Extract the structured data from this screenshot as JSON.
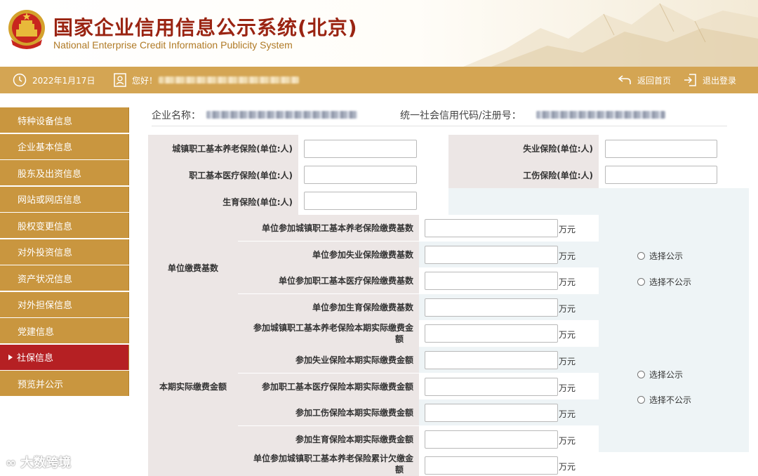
{
  "header": {
    "title_cn": "国家企业信用信息公示系统(北京)",
    "title_en": "National Enterprise Credit Information Publicity System"
  },
  "topbar": {
    "date": "2022年1月17日",
    "greeting": "您好！",
    "home_label": "返回首页",
    "logout_label": "退出登录"
  },
  "sidebar": {
    "items": [
      {
        "label": "特种设备信息"
      },
      {
        "label": "企业基本信息"
      },
      {
        "label": "股东及出资信息"
      },
      {
        "label": "网站或网店信息"
      },
      {
        "label": "股权变更信息"
      },
      {
        "label": "对外投资信息"
      },
      {
        "label": "资产状况信息"
      },
      {
        "label": "对外担保信息"
      },
      {
        "label": "党建信息"
      },
      {
        "label": "社保信息"
      },
      {
        "label": "预览并公示"
      }
    ],
    "active_index": 9
  },
  "company": {
    "name_label": "企业名称：",
    "code_label": "统一社会信用代码/注册号："
  },
  "insured": {
    "urban_pension": "城镇职工基本养老保险(单位:人)",
    "unemployment": "失业保险(单位:人)",
    "medical": "职工基本医疗保险(单位:人)",
    "injury": "工伤保险(单位:人)",
    "maternity": "生育保险(单位:人)"
  },
  "base": {
    "group_label": "单位缴费基数",
    "rows": [
      "单位参加城镇职工基本养老保险缴费基数",
      "单位参加失业保险缴费基数",
      "单位参加职工基本医疗保险缴费基数",
      "单位参加生育保险缴费基数"
    ]
  },
  "actual": {
    "group_label": "本期实际缴费金额",
    "row1_line1": "参加城镇职工基本养老保险本期实际缴费金",
    "row1_line2": "额",
    "rows": [
      "参加失业保险本期实际缴费金额",
      "参加职工基本医疗保险本期实际缴费金额",
      "参加工伤保险本期实际缴费金额",
      "参加生育保险本期实际缴费金额"
    ]
  },
  "arrears": {
    "row1_line1": "单位参加城镇职工基本养老保险累计欠缴金",
    "row1_line2": "额"
  },
  "unit": "万元",
  "radio": {
    "publish": "选择公示",
    "no_publish": "选择不公示"
  },
  "watermark": "大数跨境",
  "colors": {
    "topbar": "#d4a553",
    "sidebar": "#c9963f",
    "sidebar_active": "#b52023",
    "title": "#9a2412",
    "label_bg": "#ece6e5"
  }
}
